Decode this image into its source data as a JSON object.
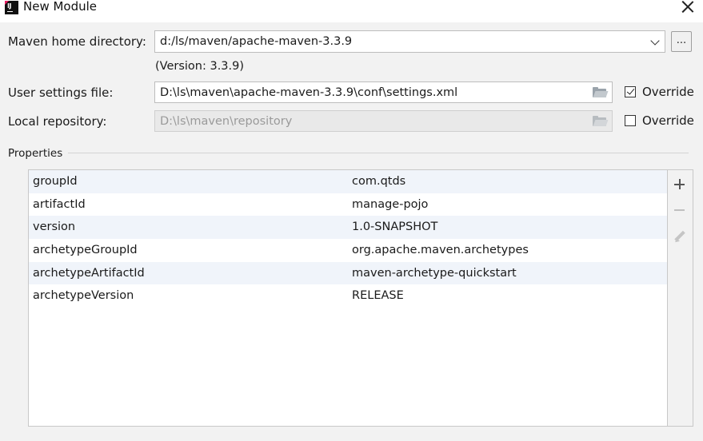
{
  "window": {
    "title": "New Module"
  },
  "maven": {
    "home_label": "Maven home directory:",
    "home_value": "d:/ls/maven/apache-maven-3.3.9",
    "browse_label": "...",
    "version_text": "(Version: 3.3.9)",
    "user_settings_label": "User settings file:",
    "user_settings_value": "D:\\ls\\maven\\apache-maven-3.3.9\\conf\\settings.xml",
    "user_settings_override_label": "Override",
    "user_settings_override_checked": true,
    "local_repo_label": "Local repository:",
    "local_repo_value": "D:\\ls\\maven\\repository",
    "local_repo_override_label": "Override",
    "local_repo_override_checked": false
  },
  "properties": {
    "section_label": "Properties",
    "rows": [
      {
        "key": "groupId",
        "value": "com.qtds"
      },
      {
        "key": "artifactId",
        "value": "manage-pojo"
      },
      {
        "key": "version",
        "value": "1.0-SNAPSHOT"
      },
      {
        "key": "archetypeGroupId",
        "value": "org.apache.maven.archetypes"
      },
      {
        "key": "archetypeArtifactId",
        "value": "maven-archetype-quickstart"
      },
      {
        "key": "archetypeVersion",
        "value": "RELEASE"
      }
    ],
    "toolbar_icons": [
      "plus-icon",
      "minus-icon",
      "edit-icon"
    ]
  },
  "colors": {
    "row_alt": "#f0f4fa",
    "dialog_bg": "#f2f2f2"
  }
}
